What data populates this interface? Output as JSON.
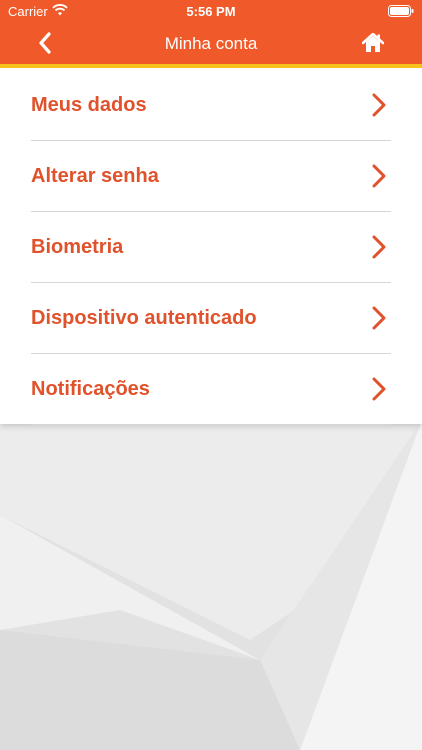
{
  "status_bar": {
    "carrier": "Carrier",
    "time": "5:56 PM"
  },
  "nav": {
    "title": "Minha conta",
    "back_icon": "chevron-left-icon",
    "home_icon": "home-icon"
  },
  "menu": {
    "items": [
      {
        "label": "Meus dados"
      },
      {
        "label": "Alterar senha"
      },
      {
        "label": "Biometria"
      },
      {
        "label": "Dispositivo autenticado"
      },
      {
        "label": "Notificações"
      }
    ]
  },
  "colors": {
    "header": "#f05a2a",
    "stripe": "#f6c21b",
    "accent_text": "#e0522b",
    "divider": "#d6d6d6"
  }
}
